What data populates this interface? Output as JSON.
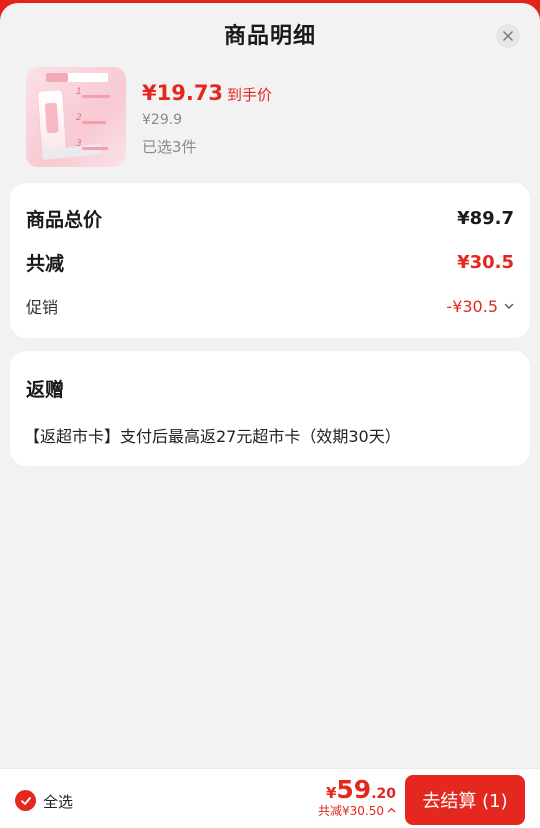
{
  "header": {
    "title": "商品明细"
  },
  "product": {
    "price": "¥19.73",
    "price_tag": "到手价",
    "original_price": "¥29.9",
    "selected": "已选3件"
  },
  "summary": {
    "total_label": "商品总价",
    "total_value": "¥89.7",
    "reduce_label": "共减",
    "reduce_value": "¥30.5",
    "promo_label": "促销",
    "promo_value": "-¥30.5"
  },
  "gift": {
    "title": "返赠",
    "text": "【返超市卡】支付后最高返27元超市卡（效期30天）"
  },
  "footer": {
    "select_all": "全选",
    "currency": "¥",
    "total_int": "59",
    "total_dec": ".20",
    "saved": "共减¥30.50",
    "checkout": "去结算 (1)"
  },
  "colors": {
    "accent": "#e4281f",
    "background": "#f2f2f2"
  },
  "icons": [
    "close-icon",
    "chevron-down-icon",
    "check-icon",
    "chevron-up-icon"
  ]
}
